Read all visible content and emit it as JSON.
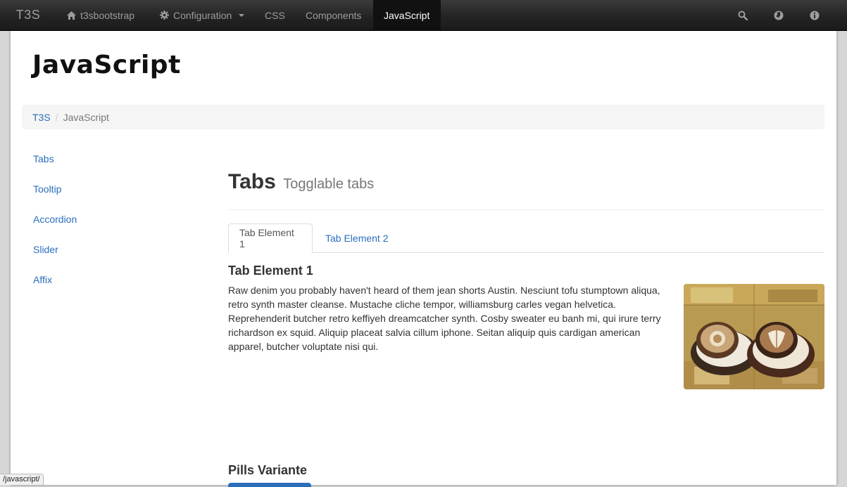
{
  "navbar": {
    "brand": "T3S",
    "items": [
      {
        "label": "t3sbootstrap",
        "icon": "home-icon"
      },
      {
        "label": "Configuration",
        "icon": "gear-icon",
        "dropdown": true
      },
      {
        "label": "CSS"
      },
      {
        "label": "Components"
      },
      {
        "label": "JavaScript",
        "active": true
      }
    ],
    "right_icons": [
      "search-icon",
      "globe-icon",
      "info-icon"
    ]
  },
  "page": {
    "title": "JavaScript"
  },
  "breadcrumb": {
    "home": "T3S",
    "current": "JavaScript"
  },
  "sidenav": [
    "Tabs",
    "Tooltip",
    "Accordion",
    "Slider",
    "Affix"
  ],
  "section": {
    "heading": "Tabs",
    "subheading": "Togglable tabs"
  },
  "tabs": [
    {
      "label": "Tab Element 1",
      "active": true
    },
    {
      "label": "Tab Element 2",
      "active": false
    }
  ],
  "pane": {
    "title": "Tab Element 1",
    "text": "Raw denim you probably haven't heard of them jean shorts Austin. Nesciunt tofu stumptown aliqua, retro synth master cleanse. Mustache cliche tempor, williamsburg carles vegan helvetica. Reprehenderit butcher retro keffiyeh dreamcatcher synth. Cosby sweater eu banh mi, qui irure terry richardson ex squid. Aliquip placeat salvia cillum iphone. Seitan aliquip quis cardigan american apparel, butcher voluptate nisi qui.",
    "image": "coffee-cups-photo"
  },
  "pills": {
    "title": "Pills Variante"
  },
  "status_url": "/javascript/",
  "colors": {
    "navbar_bg": "#222222",
    "link": "#2a6ebb",
    "active_nav_bg": "#111111"
  }
}
